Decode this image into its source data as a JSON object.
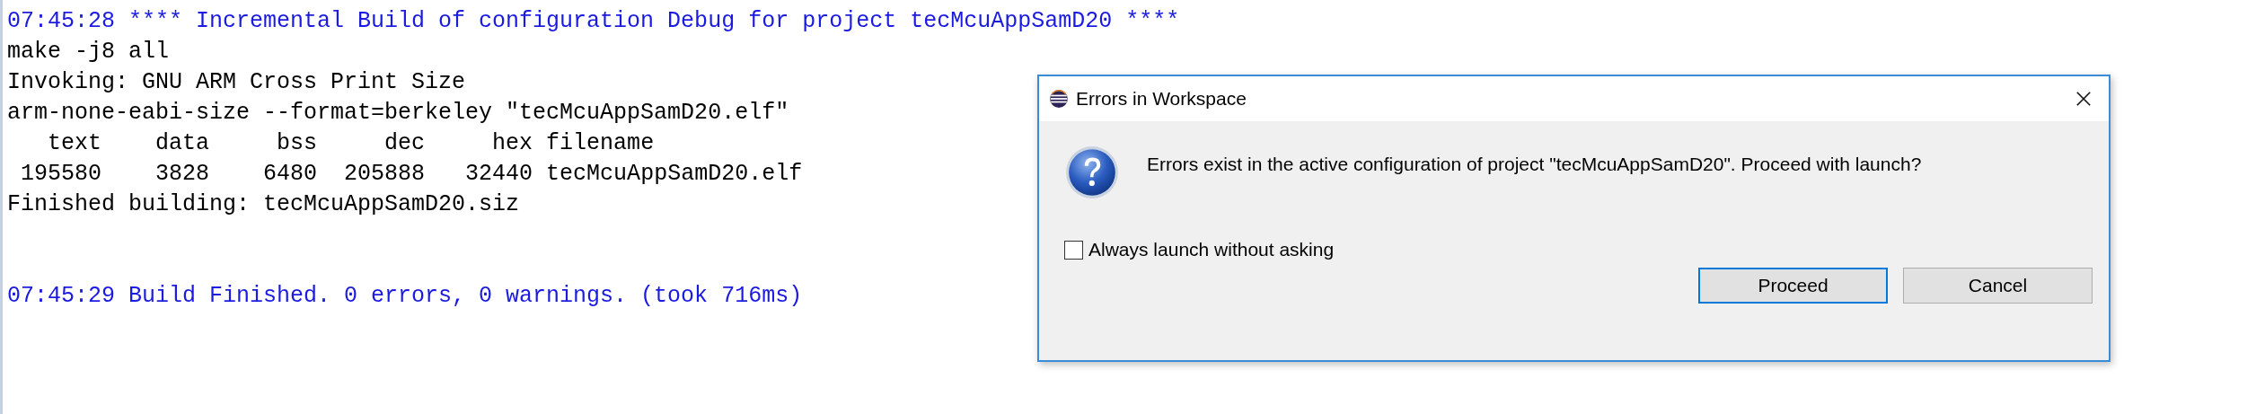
{
  "console": {
    "lines": [
      {
        "kind": "info",
        "text": "07:45:28 **** Incremental Build of configuration Debug for project tecMcuAppSamD20 ****"
      },
      {
        "kind": "output",
        "text": "make -j8 all"
      },
      {
        "kind": "output",
        "text": "Invoking: GNU ARM Cross Print Size"
      },
      {
        "kind": "output",
        "text": "arm-none-eabi-size --format=berkeley \"tecMcuAppSamD20.elf\""
      },
      {
        "kind": "output",
        "text": "   text\t   data\t    bss\t    dec\t    hex\tfilename"
      },
      {
        "kind": "output",
        "text": " 195580\t   3828\t   6480\t 205888\t  32440\ttecMcuAppSamD20.elf"
      },
      {
        "kind": "output",
        "text": "Finished building: tecMcuAppSamD20.siz"
      },
      {
        "kind": "summary",
        "text": "07:45:29 Build Finished. 0 errors, 0 warnings. (took 716ms)"
      }
    ]
  },
  "dialog": {
    "title": "Errors in Workspace",
    "message": "Errors exist in the active configuration of project \"tecMcuAppSamD20\". Proceed with launch?",
    "checkbox": {
      "label": "Always launch without asking",
      "checked": false
    },
    "buttons": [
      {
        "label": "Proceed",
        "default": true
      },
      {
        "label": "Cancel",
        "default": false
      }
    ]
  }
}
